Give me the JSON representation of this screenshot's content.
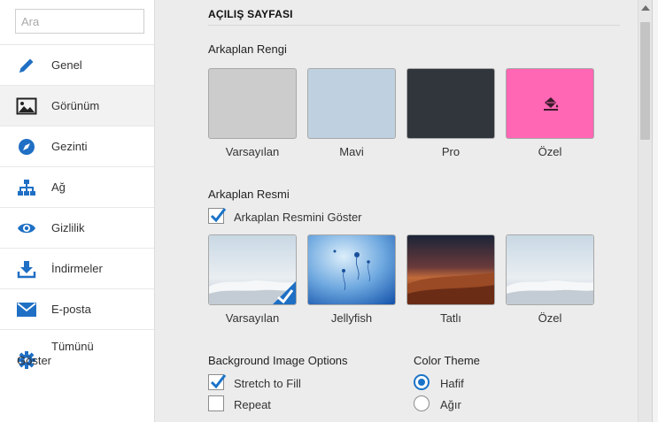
{
  "search": {
    "placeholder": "Ara"
  },
  "sidebar": {
    "items": [
      {
        "label": "Genel",
        "icon": "pencil-icon"
      },
      {
        "label": "Görünüm",
        "icon": "image-icon",
        "active": true
      },
      {
        "label": "Gezinti",
        "icon": "compass-icon"
      },
      {
        "label": "Ağ",
        "icon": "network-icon"
      },
      {
        "label": "Gizlilik",
        "icon": "eye-icon"
      },
      {
        "label": "İndirmeler",
        "icon": "download-icon"
      },
      {
        "label": "E-posta",
        "icon": "mail-icon"
      },
      {
        "label_line1": "Tümünü",
        "label_line2": "Göster",
        "icon": "gear-icon"
      }
    ]
  },
  "main": {
    "title": "AÇILIŞ SAYFASI",
    "bg_color": {
      "heading": "Arkaplan Rengi",
      "options": [
        {
          "label": "Varsayılan",
          "color": "#cccccc"
        },
        {
          "label": "Mavi",
          "color": "#bfd1e0"
        },
        {
          "label": "Pro",
          "color": "#31363d"
        },
        {
          "label": "Özel",
          "color": "#ff66b3",
          "icon": "paint-bucket-icon"
        }
      ]
    },
    "bg_image": {
      "heading": "Arkaplan Resmi",
      "show_label": "Arkaplan Resmini Göster",
      "show_checked": true,
      "options": [
        {
          "label": "Varsayılan",
          "selected": true
        },
        {
          "label": "Jellyfish"
        },
        {
          "label": "Tatlı"
        },
        {
          "label": "Özel"
        }
      ]
    },
    "bg_options": {
      "heading": "Background Image Options",
      "stretch_label": "Stretch to Fill",
      "stretch_checked": true,
      "repeat_label": "Repeat",
      "repeat_checked": false
    },
    "color_theme": {
      "heading": "Color Theme",
      "light_label": "Hafif",
      "dark_label": "Ağır",
      "selected": "Hafif"
    }
  },
  "colors": {
    "accent": "#1a73c8",
    "icon_blue": "#1f6fc4"
  }
}
